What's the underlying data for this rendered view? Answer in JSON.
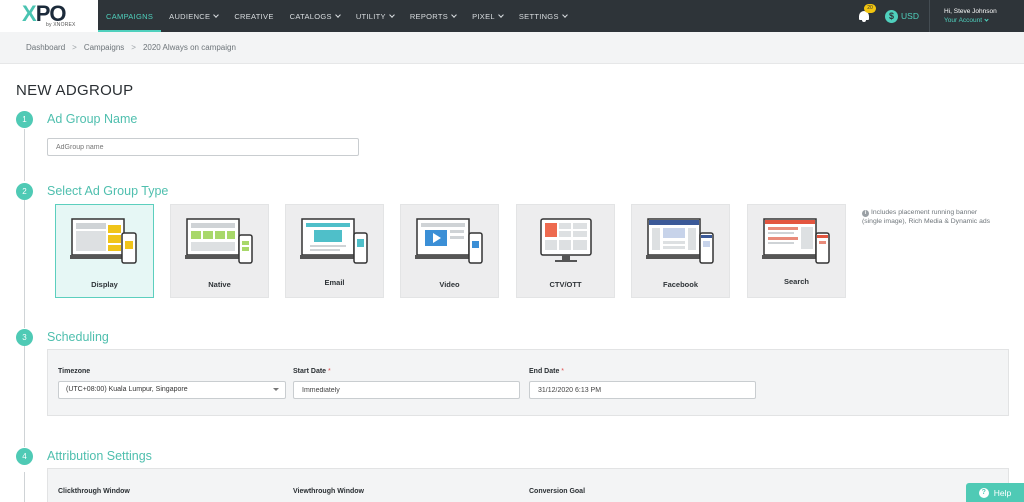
{
  "brand": {
    "logo_text_x": "X",
    "logo_text_po": "PO",
    "logo_sub": "by XNOREX",
    "accent": "#4fcab5",
    "nav_bg": "#2e3439"
  },
  "nav": {
    "items": [
      {
        "label": "CAMPAIGNS",
        "active": true
      },
      {
        "label": "AUDIENCE",
        "dropdown": true
      },
      {
        "label": "CREATIVE"
      },
      {
        "label": "CATALOGS",
        "dropdown": true
      },
      {
        "label": "UTILITY",
        "dropdown": true
      },
      {
        "label": "REPORTS",
        "dropdown": true
      },
      {
        "label": "PIXEL",
        "dropdown": true
      },
      {
        "label": "SETTINGS",
        "dropdown": true
      }
    ],
    "notification_count": "20",
    "currency": "USD",
    "greeting": "Hi, Steve Johnson",
    "account_link": "Your Account"
  },
  "breadcrumb": {
    "items": [
      "Dashboard",
      "Campaigns",
      "2020 Always on campaign"
    ]
  },
  "page": {
    "title": "NEW ADGROUP"
  },
  "steps": {
    "step1": {
      "number": "1",
      "title": "Ad Group Name",
      "placeholder": "AdGroup name"
    },
    "step2": {
      "number": "2",
      "title": "Select Ad Group Type",
      "types": [
        {
          "label": "Display",
          "icon": "display-icon",
          "selected": true
        },
        {
          "label": "Native",
          "icon": "native-icon"
        },
        {
          "label": "Email",
          "icon": "email-icon"
        },
        {
          "label": "Video",
          "icon": "video-icon"
        },
        {
          "label": "CTV/OTT",
          "icon": "ctv-icon"
        },
        {
          "label": "Facebook",
          "icon": "facebook-icon"
        },
        {
          "label": "Search",
          "icon": "search-icon"
        }
      ],
      "note": "Includes placement running banner (single image), Rich Media & Dynamic ads"
    },
    "step3": {
      "number": "3",
      "title": "Scheduling",
      "timezone_label": "Timezone",
      "timezone_value": "(UTC+08:00) Kuala Lumpur, Singapore",
      "start_label": "Start Date",
      "start_value": "Immediately",
      "end_label": "End Date",
      "end_value": "31/12/2020 6:13 PM",
      "required_mark": "*"
    },
    "step4": {
      "number": "4",
      "title": "Attribution Settings",
      "clickthrough_label": "Clickthrough Window",
      "viewthrough_label": "Viewthrough Window",
      "conversion_label": "Conversion Goal"
    }
  },
  "help": {
    "label": "Help"
  }
}
